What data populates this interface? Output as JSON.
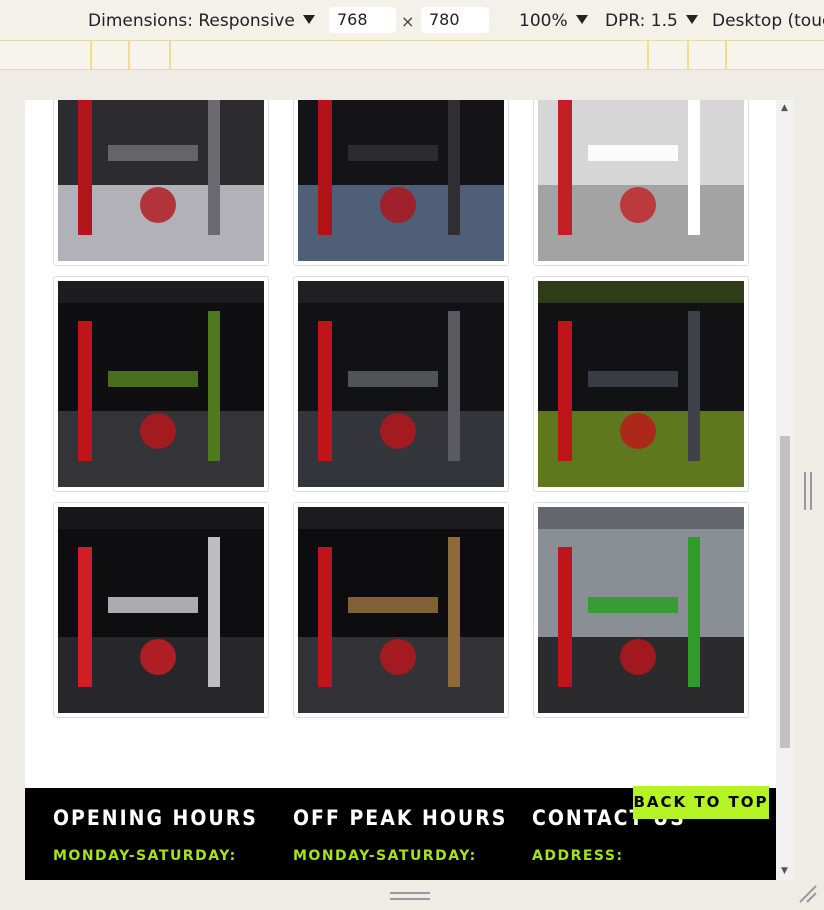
{
  "toolbar": {
    "dimensions_label": "Dimensions: Responsive",
    "width_value": "768",
    "height_value": "780",
    "times": "×",
    "zoom": "100%",
    "dpr": "DPR: 1.5",
    "device_mode": "Desktop (touc"
  },
  "gallery": {
    "images": [
      {
        "name": "dumbbell-rack-photo",
        "colors": [
          "#2b2b30",
          "#c9c9cf",
          "#b3151b",
          "#6a6a70"
        ]
      },
      {
        "name": "cross-trainer-photo",
        "colors": [
          "#141418",
          "#5a6c8a",
          "#b31218",
          "#2e2e33"
        ]
      },
      {
        "name": "cable-machine-photo",
        "colors": [
          "#d6d6d6",
          "#9a9a9a",
          "#c21f24",
          "#ffffff"
        ]
      },
      {
        "name": "gym-floor-machines-photo",
        "colors": [
          "#0f0f12",
          "#3a3a40",
          "#c0141b",
          "#4f7b1e"
        ]
      },
      {
        "name": "benches-racks-photo",
        "colors": [
          "#121214",
          "#3b3b42",
          "#c0141b",
          "#5a5a60"
        ]
      },
      {
        "name": "turf-area-photo",
        "colors": [
          "#121214",
          "#6b8b1e",
          "#c0141b",
          "#40404a"
        ]
      },
      {
        "name": "punch-bag-photo",
        "colors": [
          "#0e0e10",
          "#2b2b30",
          "#d11d24",
          "#bdbdc2"
        ]
      },
      {
        "name": "rack-upright-photo",
        "colors": [
          "#0d0d0f",
          "#3a3a3e",
          "#c0141b",
          "#8c6a3a"
        ]
      },
      {
        "name": "weight-plates-photo",
        "colors": [
          "#8a8f96",
          "#1a1a1c",
          "#c0141b",
          "#2f9c2a"
        ]
      }
    ]
  },
  "footer": {
    "columns": [
      {
        "title": "OPENING HOURS",
        "subtitle": "MONDAY-SATURDAY:"
      },
      {
        "title": "OFF PEAK HOURS",
        "subtitle": "MONDAY-SATURDAY:"
      },
      {
        "title": "CONTACT US",
        "subtitle": "ADDRESS:"
      }
    ],
    "back_to_top": "BACK TO TOP"
  },
  "colors": {
    "accent_green": "#a3e31a",
    "button_green": "#b5f423",
    "footer_bg": "#000000"
  }
}
